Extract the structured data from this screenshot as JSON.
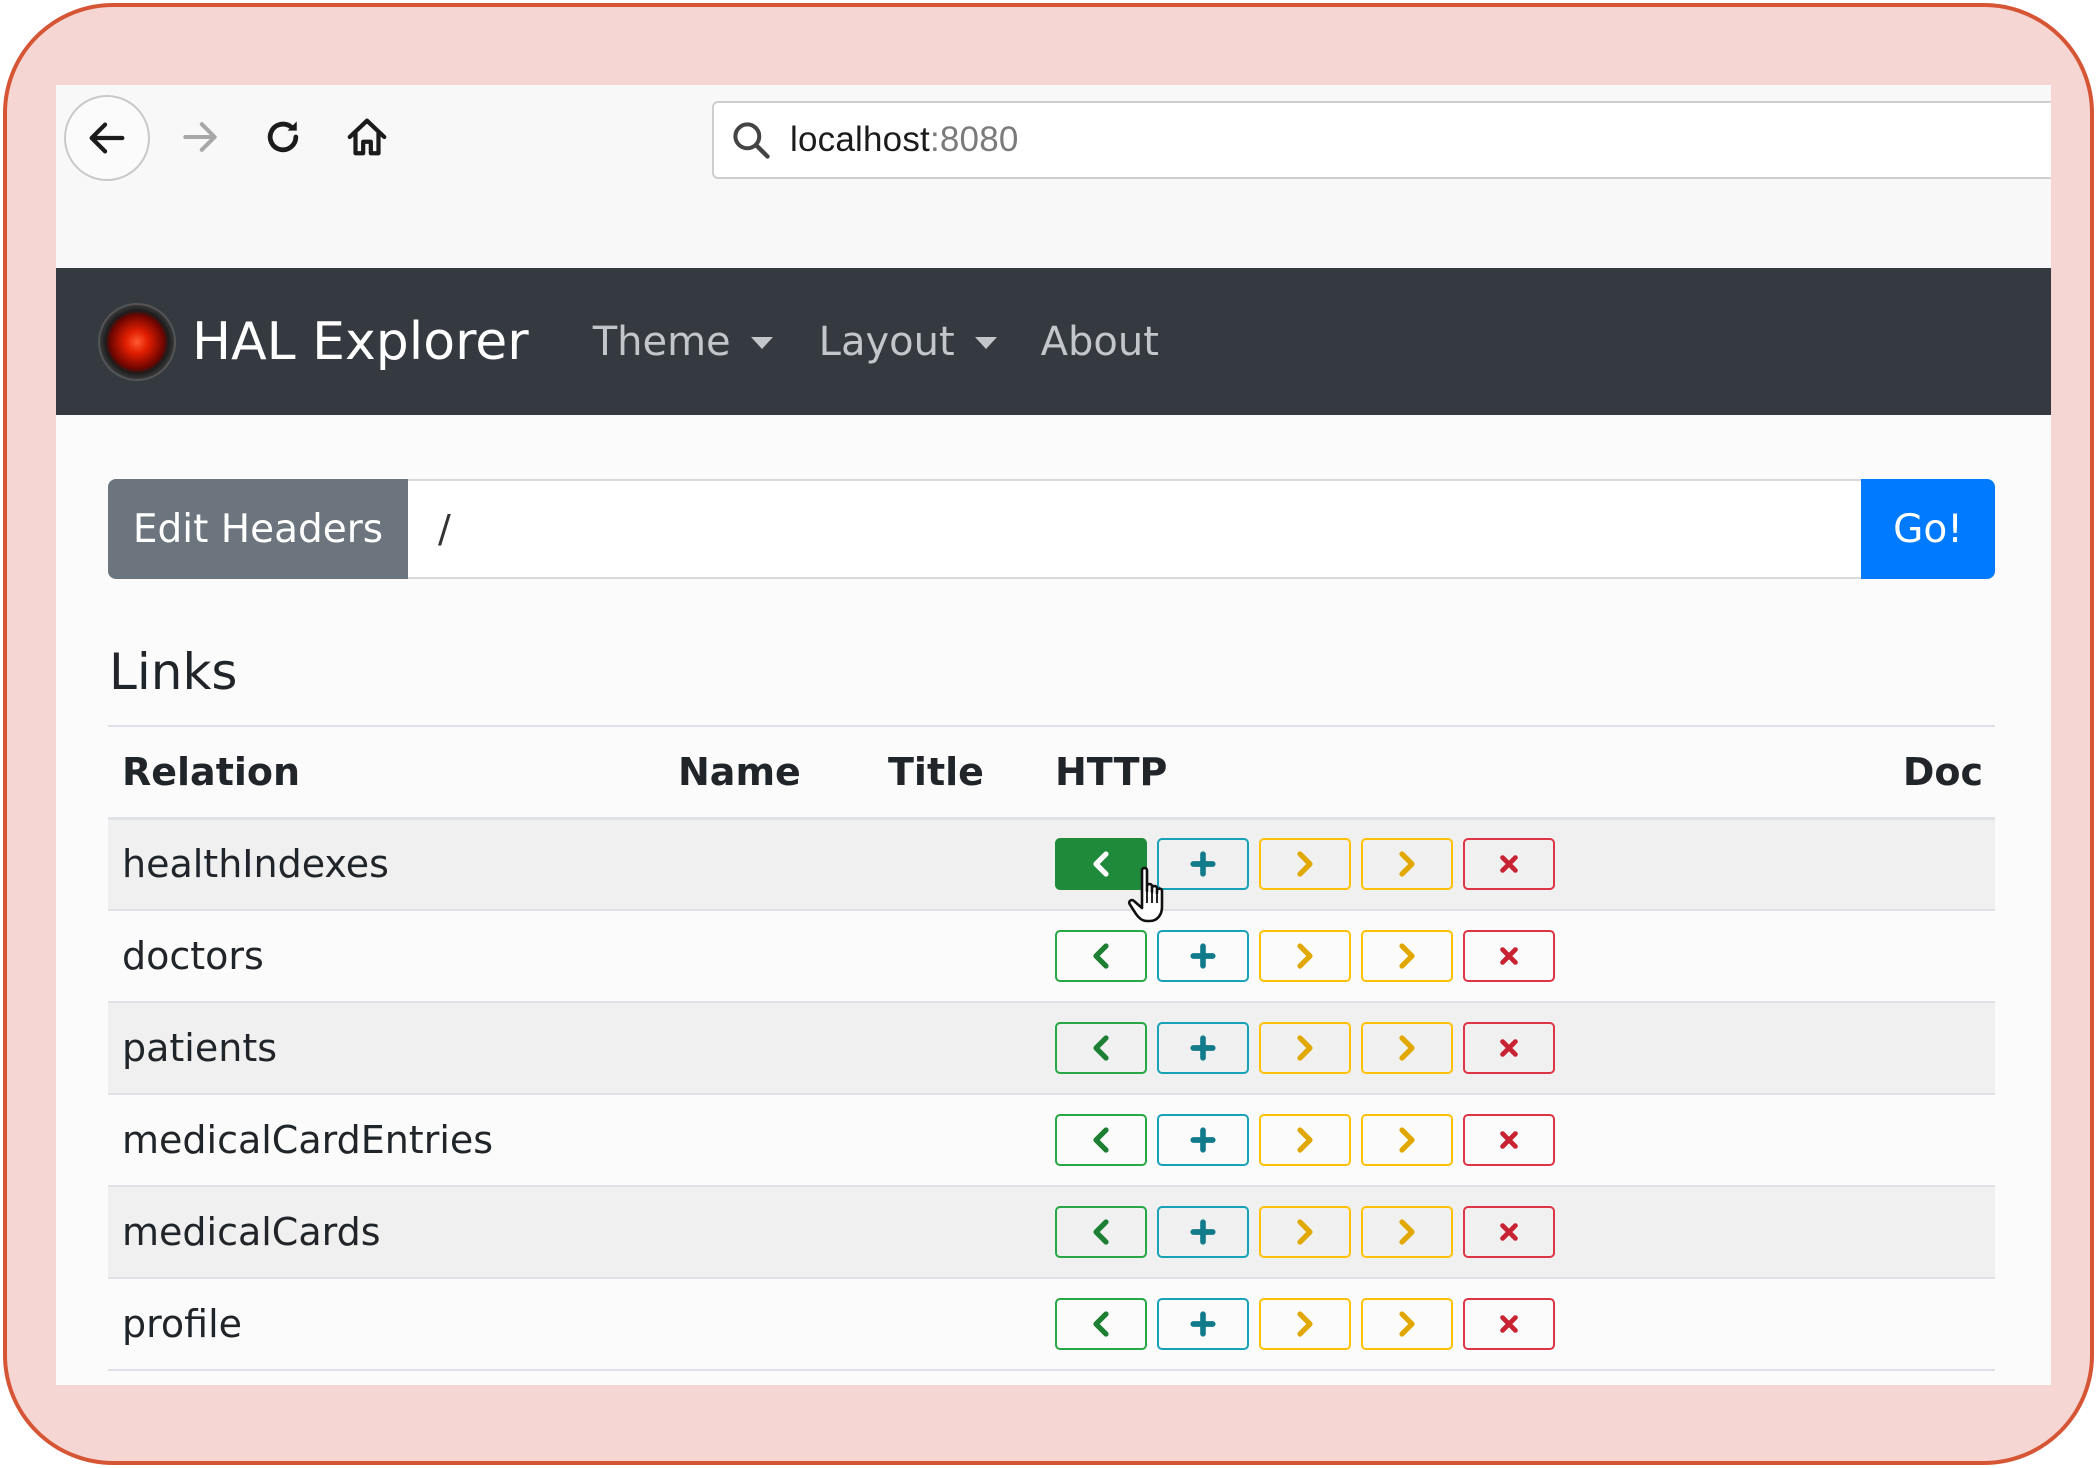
{
  "browser": {
    "url_host": "localhost",
    "url_port": ":8080"
  },
  "navbar": {
    "brand": "HAL Explorer",
    "items": [
      {
        "label": "Theme",
        "dropdown": true
      },
      {
        "label": "Layout",
        "dropdown": true
      },
      {
        "label": "About",
        "dropdown": false
      }
    ]
  },
  "request": {
    "edit_headers_label": "Edit Headers",
    "uri_value": "/",
    "go_label": "Go!"
  },
  "links": {
    "heading": "Links",
    "columns": [
      "Relation",
      "Name",
      "Title",
      "HTTP",
      "Doc"
    ],
    "rows": [
      {
        "relation": "healthIndexes",
        "name": "",
        "title": "",
        "doc": ""
      },
      {
        "relation": "doctors",
        "name": "",
        "title": "",
        "doc": ""
      },
      {
        "relation": "patients",
        "name": "",
        "title": "",
        "doc": ""
      },
      {
        "relation": "medicalCardEntries",
        "name": "",
        "title": "",
        "doc": ""
      },
      {
        "relation": "medicalCards",
        "name": "",
        "title": "",
        "doc": ""
      },
      {
        "relation": "profile",
        "name": "",
        "title": "",
        "doc": ""
      }
    ],
    "http_buttons": [
      {
        "method": "GET",
        "icon": "chevron-left-icon",
        "color": "#28a745"
      },
      {
        "method": "POST",
        "icon": "plus-icon",
        "color": "#17a2b8"
      },
      {
        "method": "PUT",
        "icon": "chevron-right-icon",
        "color": "#ffc107"
      },
      {
        "method": "PATCH",
        "icon": "chevron-right-icon",
        "color": "#ffc107"
      },
      {
        "method": "DELETE",
        "icon": "close-icon",
        "color": "#dc3545"
      }
    ],
    "hovered_row": 0
  },
  "colors": {
    "navbar_bg": "#343a40",
    "go_button": "#007bff",
    "edit_headers_button": "#6c757d",
    "frame_border": "#d65535",
    "frame_bg": "#f6d6d2"
  }
}
